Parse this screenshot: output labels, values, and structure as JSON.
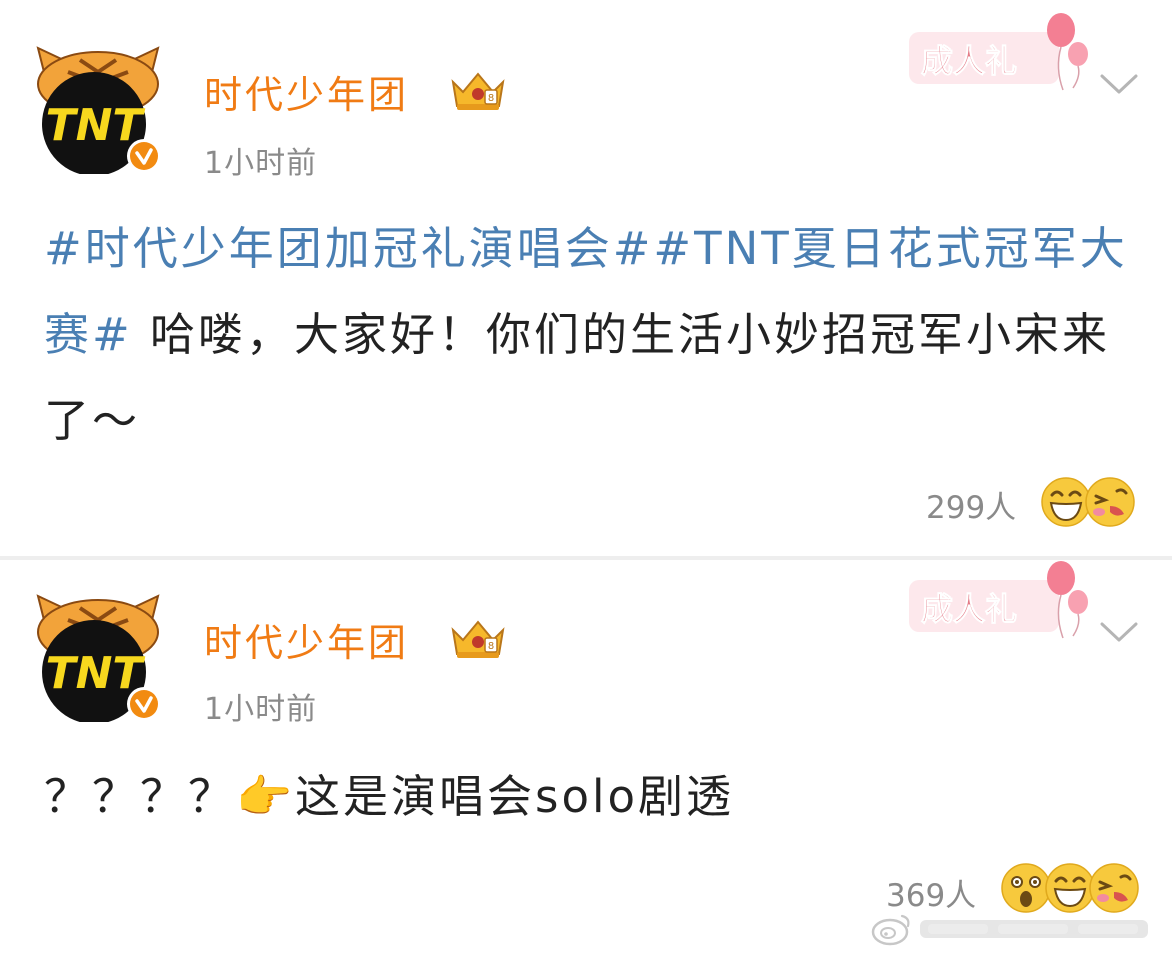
{
  "posts": [
    {
      "author": "时代少年团",
      "avatar_text": "TNT",
      "verified_icon": "verified-badge-icon",
      "time": "1小时前",
      "badge_text": "成人礼",
      "topics": [
        "#时代少年团加冠礼演唱会#",
        "#TNT夏日花式冠军大赛#"
      ],
      "text": " 哈喽，大家好！你们的生活小妙招冠军小宋来了～",
      "likes": "299人",
      "reactions": [
        "laugh-emoji",
        "blush-emoji"
      ]
    },
    {
      "author": "时代少年团",
      "avatar_text": "TNT",
      "verified_icon": "verified-badge-icon",
      "time": "1小时前",
      "badge_text": "成人礼",
      "prefix": "？？？？",
      "pointing_emoji": "👉",
      "text": "这是演唱会solo剧透",
      "likes": "369人",
      "reactions": [
        "surprised-emoji",
        "laugh-emoji",
        "blush-emoji"
      ]
    }
  ],
  "colors": {
    "author": "#f07b14",
    "topic": "#4a7fb3",
    "meta": "#8a8a8a",
    "body": "#222222",
    "badge": "#e47a86"
  }
}
